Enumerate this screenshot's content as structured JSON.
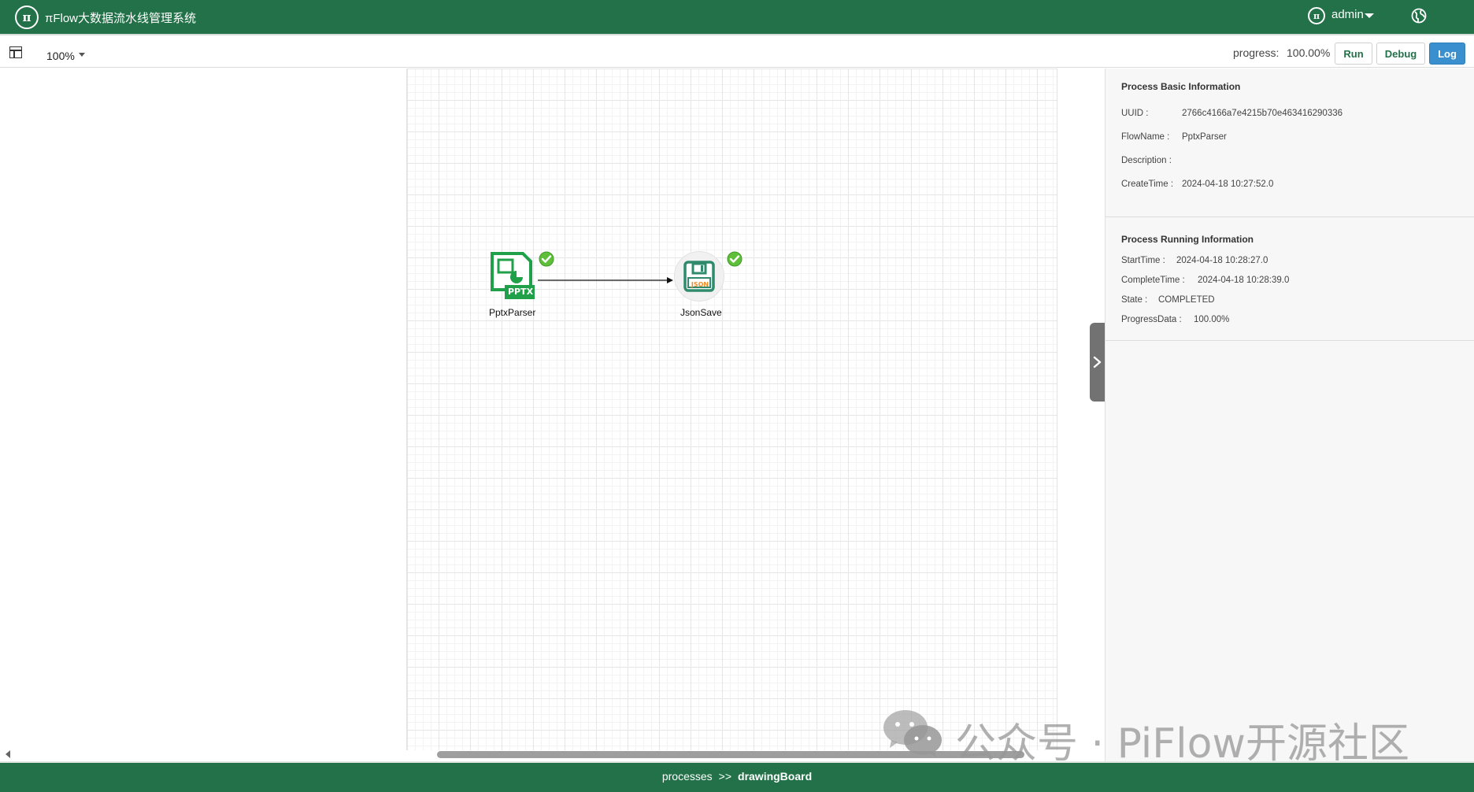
{
  "header": {
    "logo_text": "π",
    "title": "πFlow大数据流水线管理系统",
    "user_icon_text": "π",
    "username": "admin"
  },
  "toolbar": {
    "zoom": "100%",
    "progress_label": "progress:",
    "progress_value": "100.00%",
    "run_label": "Run",
    "debug_label": "Debug",
    "log_label": "Log"
  },
  "canvas": {
    "nodes": [
      {
        "label": "PptxParser",
        "icon": "pptx-file-icon",
        "icon_text": "PPTX",
        "status": "completed"
      },
      {
        "label": "JsonSave",
        "icon": "json-save-icon",
        "icon_text": "JSON",
        "status": "completed"
      }
    ]
  },
  "panel": {
    "basic": {
      "title": "Process Basic Information",
      "uuid_label": "UUID :",
      "uuid": "2766c4166a7e4215b70e463416290336",
      "flowname_label": "FlowName :",
      "flowname": "PptxParser",
      "description_label": "Description :",
      "description": "",
      "createtime_label": "CreateTime :",
      "createtime": "2024-04-18 10:27:52.0"
    },
    "running": {
      "title": "Process Running Information",
      "starttime_label": "StartTime :",
      "starttime": "2024-04-18 10:28:27.0",
      "completetime_label": "CompleteTime :",
      "completetime": "2024-04-18 10:28:39.0",
      "state_label": "State :",
      "state": "COMPLETED",
      "progressdata_label": "ProgressData :",
      "progressdata": "100.00%"
    }
  },
  "footer": {
    "crumb_1": "processes",
    "separator": ">>",
    "crumb_2": "drawingBoard"
  },
  "watermark": {
    "text": "公众号 · PiFlow开源社区"
  },
  "colors": {
    "header_bg": "#227148",
    "node_green": "#21a04a",
    "json_orange": "#f08a24",
    "log_button": "#3a8fce"
  }
}
